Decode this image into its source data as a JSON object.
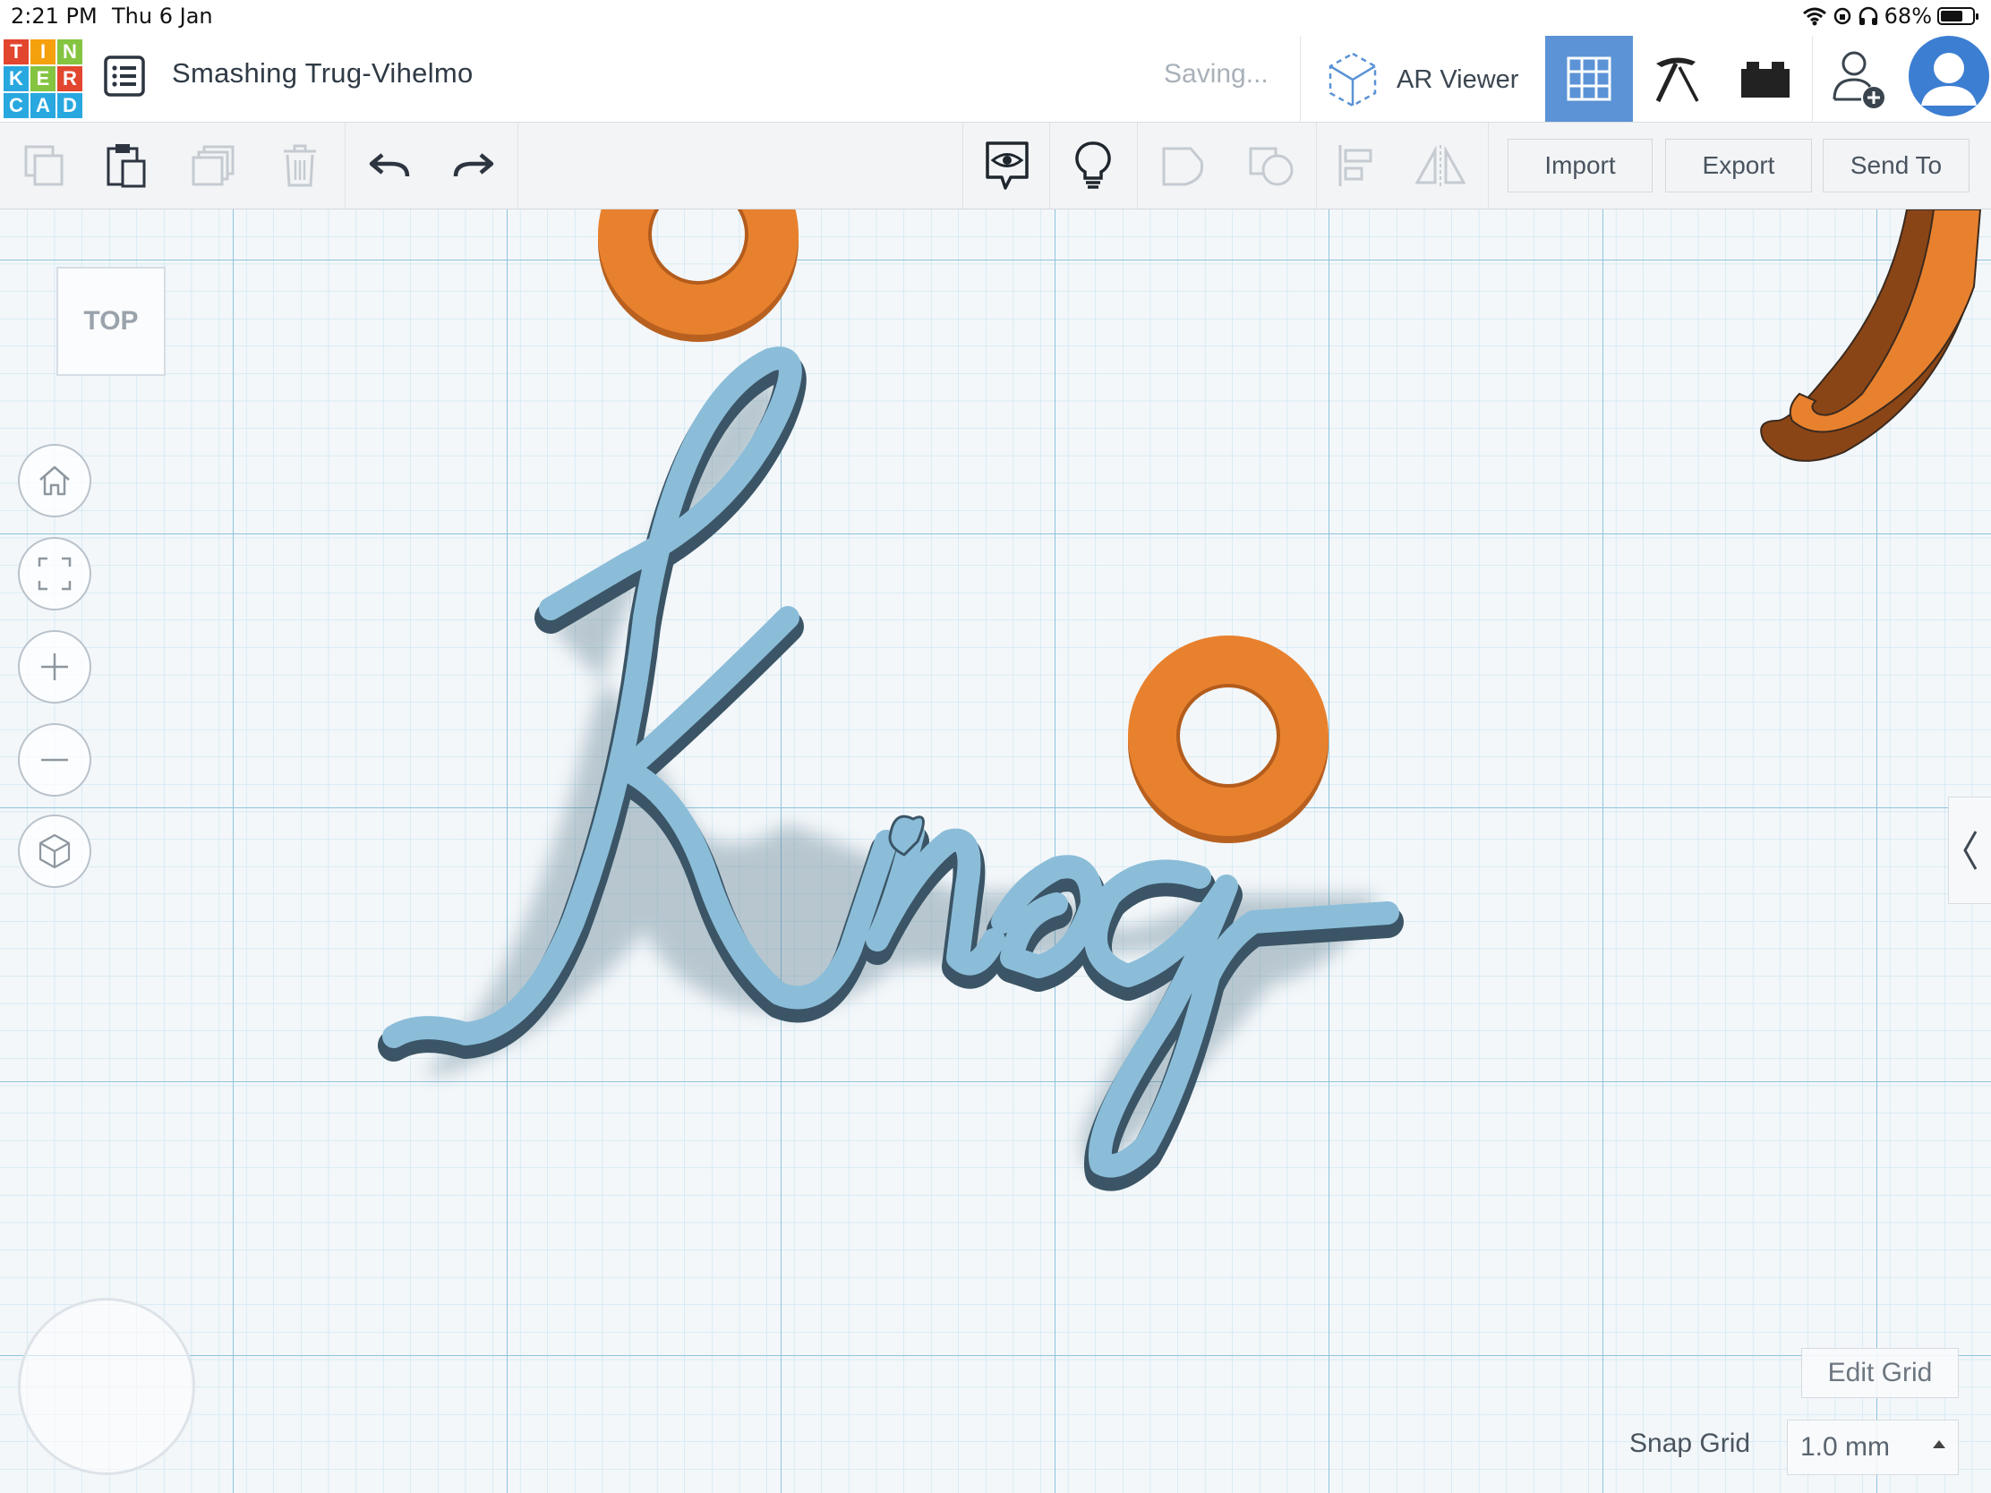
{
  "status_bar": {
    "time": "2:21 PM",
    "date": "Thu 6 Jan",
    "battery": "68%"
  },
  "app": {
    "logo_letters": [
      "T",
      "I",
      "N",
      "K",
      "E",
      "R",
      "C",
      "A",
      "D"
    ],
    "logo_colors": [
      "#e2462f",
      "#f5a00d",
      "#84c441",
      "#29a8e0",
      "#84c441",
      "#e2462f",
      "#29a8e0",
      "#29a8e0",
      "#29a8e0"
    ],
    "design_title": "Smashing Trug-Vihelmo",
    "save_status": "Saving...",
    "ar_viewer_label": "AR Viewer"
  },
  "toolbar": {
    "import_label": "Import",
    "export_label": "Export",
    "send_to_label": "Send To"
  },
  "workplane": {
    "view_label": "TOP",
    "edit_grid_label": "Edit Grid",
    "snap_grid_label": "Snap Grid",
    "snap_grid_value": "1.0 mm",
    "shape_text": "King",
    "shape_colors": {
      "text": "#8bbdd9",
      "rings": "#e8812e"
    }
  }
}
